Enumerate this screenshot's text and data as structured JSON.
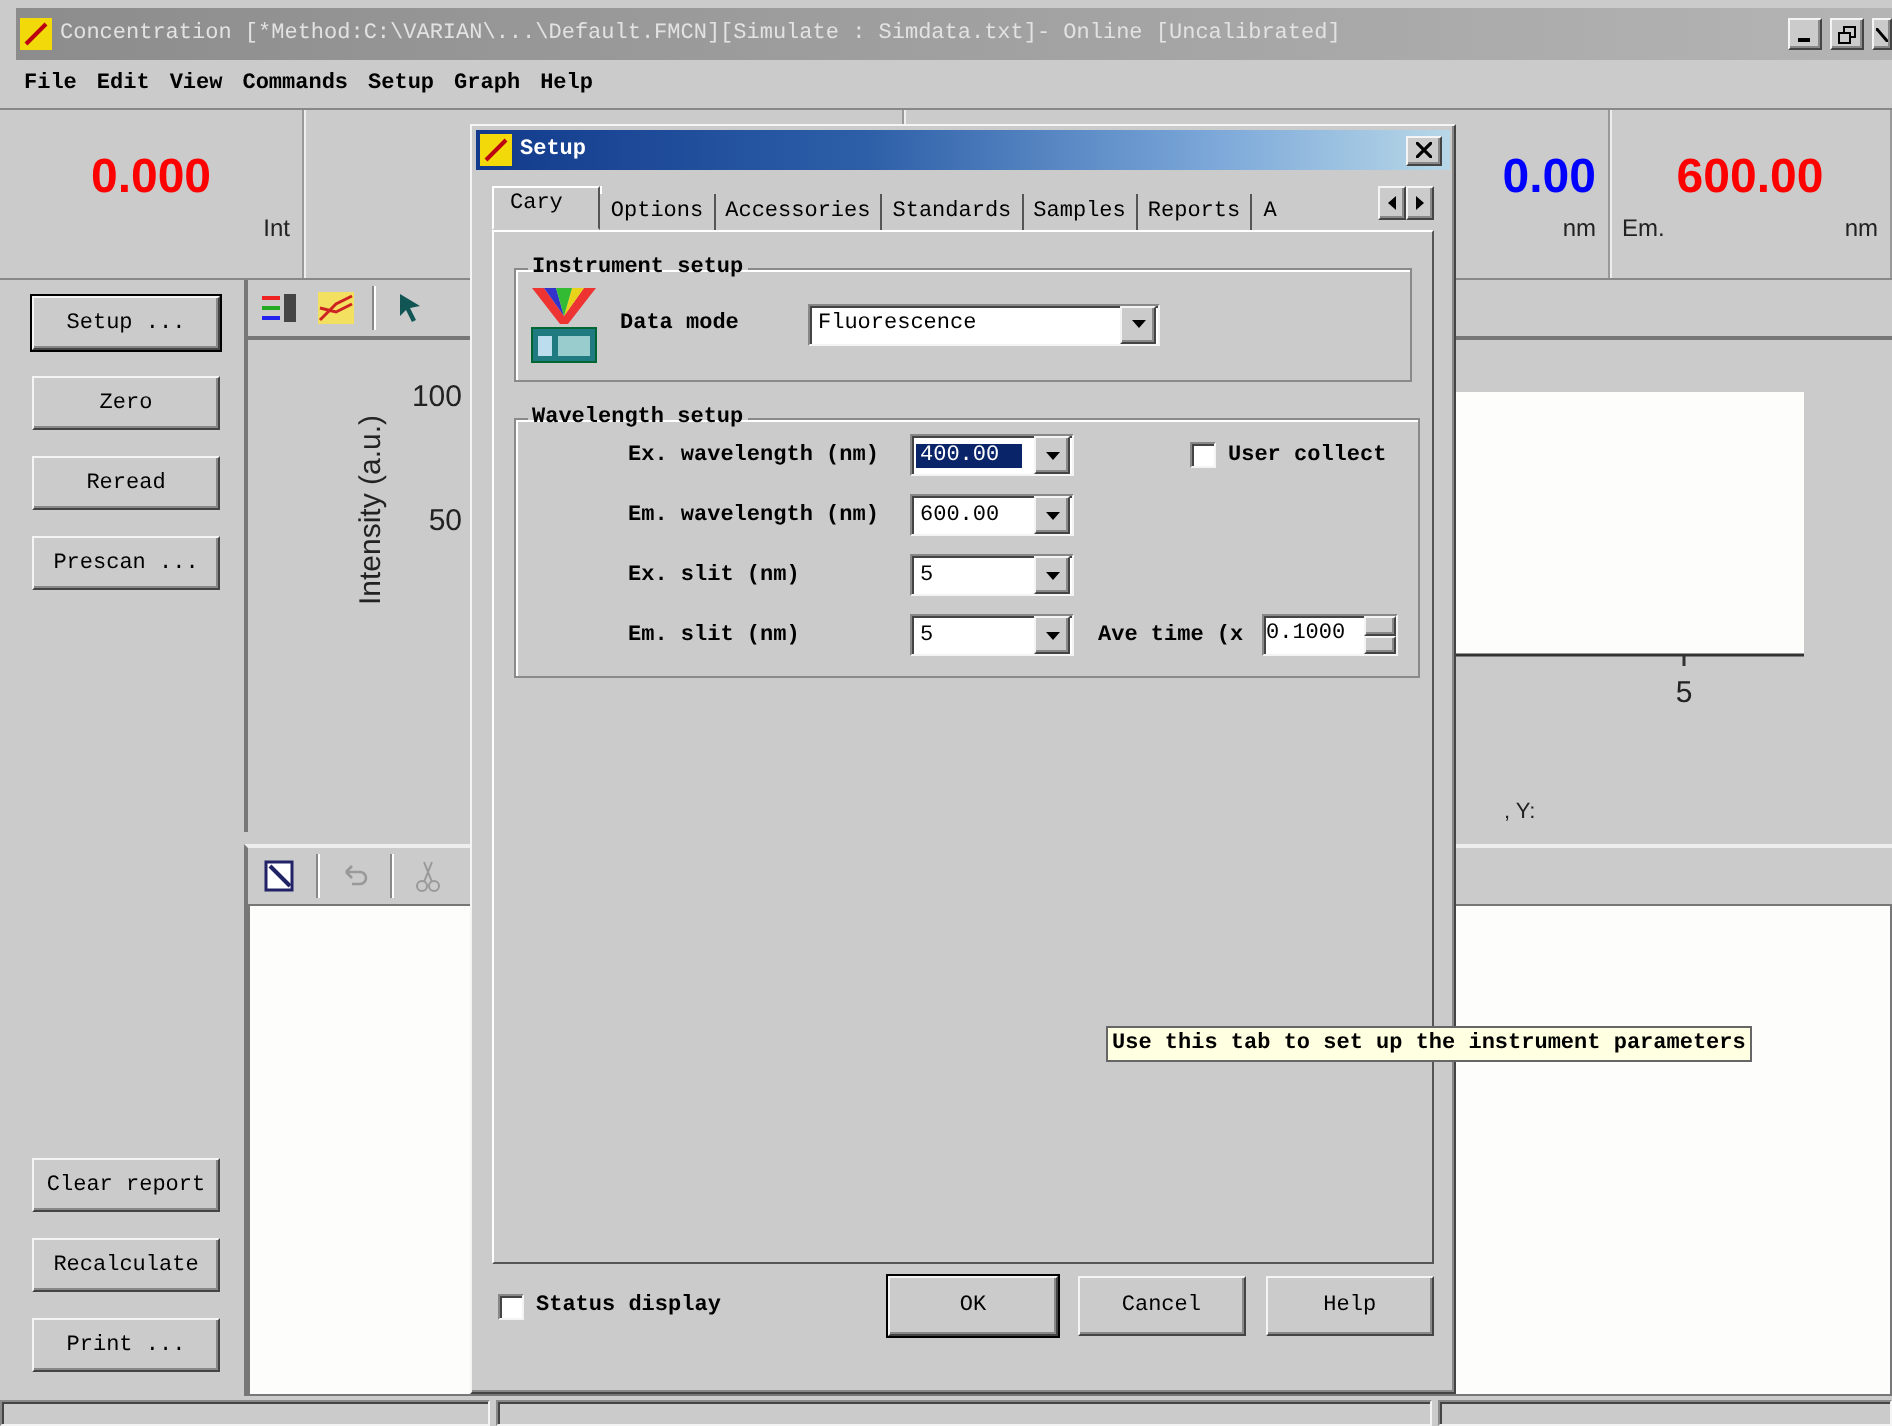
{
  "window": {
    "title": "Concentration [*Method:C:\\VARIAN\\...\\Default.FMCN][Simulate : Simdata.txt]- Online [Uncalibrated]"
  },
  "menu": [
    "File",
    "Edit",
    "View",
    "Commands",
    "Setup",
    "Graph",
    "Help"
  ],
  "readouts": [
    {
      "value": "0.000",
      "color": "#ff0000",
      "unit": "Int"
    },
    {
      "value": "0.00",
      "color": "#0000ff",
      "unit": "nm"
    },
    {
      "value": "600.00",
      "color": "#ff0000",
      "label": "Em.",
      "unit": "nm"
    }
  ],
  "side_buttons_top": [
    {
      "label": "Setup ...",
      "default": true
    },
    {
      "label": "Zero",
      "default": false
    },
    {
      "label": "Reread",
      "default": false
    },
    {
      "label": "Prescan ...",
      "default": false
    }
  ],
  "side_buttons_bottom": [
    "Clear report",
    "Recalculate",
    "Print ..."
  ],
  "graph": {
    "y_ticks": [
      "100",
      "50"
    ],
    "ylabel": "Intensity (a.u.)",
    "x_tick": "5",
    "cursor_readout": ", Y:"
  },
  "dialog": {
    "title": "Setup",
    "tabs": [
      {
        "label": "Cary",
        "selected": true
      },
      {
        "label": "Options",
        "selected": false
      },
      {
        "label": "Accessories",
        "selected": false
      },
      {
        "label": "Standards",
        "selected": false
      },
      {
        "label": "Samples",
        "selected": false
      },
      {
        "label": "Reports",
        "selected": false
      },
      {
        "label": "A",
        "selected": false
      }
    ],
    "instrument_setup": {
      "title": "Instrument setup",
      "label": "Data mode",
      "value": "Fluorescence"
    },
    "wavelength_setup": {
      "title": "Wavelength setup",
      "fields": [
        {
          "label": "Ex. wavelength (nm)",
          "value": "400.00",
          "focused": true
        },
        {
          "label": "Em. wavelength (nm)",
          "value": "600.00",
          "focused": false
        },
        {
          "label": "Ex. slit (nm)",
          "value": "5",
          "focused": false
        },
        {
          "label": "Em. slit (nm)",
          "value": "5",
          "focused": false
        }
      ],
      "user_collect": {
        "label": "User collect",
        "checked": false
      },
      "ave_time": {
        "label": "Ave time (x",
        "value": "0.1000"
      }
    },
    "status_display": {
      "label": "Status display",
      "checked": false
    },
    "buttons": [
      {
        "label": "OK",
        "default": true
      },
      {
        "label": "Cancel",
        "default": false
      },
      {
        "label": "Help",
        "default": false
      }
    ]
  },
  "tooltip": "Use this tab to set up the instrument parameters"
}
